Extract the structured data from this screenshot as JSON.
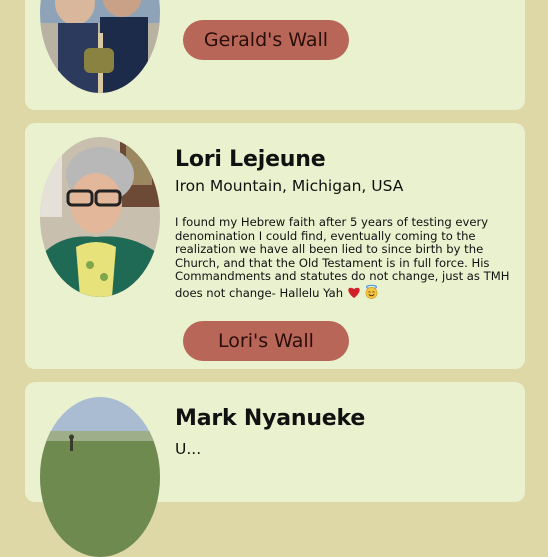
{
  "profiles": [
    {
      "wall_label": "Gerald's Wall"
    },
    {
      "name": "Lori Lejeune",
      "location": "Iron Mountain, Michigan, USA",
      "bio": "I found my Hebrew faith after 5 years of testing every denomination I could find, eventually coming to the realization we have all been lied to since birth by the Church, and that the Old Testament is in full force. His Commandments and statutes do not change, just as TMH does not change- Hallelu Yah",
      "bio_emojis": [
        "heart-emoji",
        "smiling-face-with-halo-emoji"
      ],
      "wall_label": "Lori's Wall"
    },
    {
      "name": "Mark Nyanueke",
      "location": "U..."
    }
  ],
  "colors": {
    "page_background": "#ddd8a6",
    "card_background": "#eaf1cf",
    "button_background": "#b86658",
    "heart": "#d21f2a"
  }
}
